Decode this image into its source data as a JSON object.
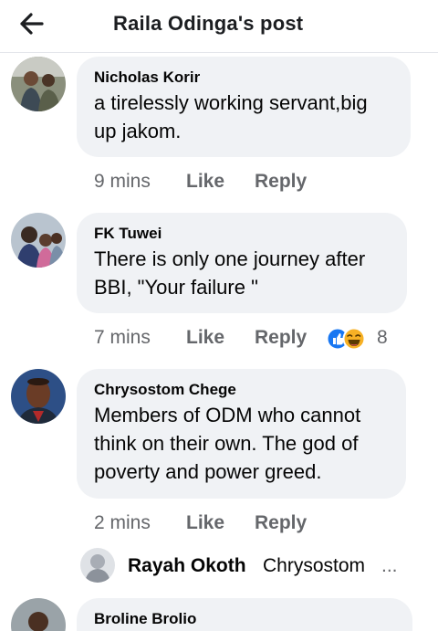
{
  "header": {
    "title": "Raila Odinga's post",
    "back_icon": "back-arrow-icon"
  },
  "comments": [
    {
      "author": "Nicholas Korir",
      "lines": [
        "a tirelessly working servant,big",
        "up jakom."
      ],
      "time": "9 mins",
      "like": "Like",
      "reply": "Reply"
    },
    {
      "author": "FK Tuwei",
      "lines": [
        "There is only one journey after",
        "BBI, \"Your failure \""
      ],
      "time": "7 mins",
      "like": "Like",
      "reply": "Reply",
      "reaction_count": "8",
      "reactions": [
        "like",
        "haha"
      ]
    },
    {
      "author": "Chrysostom Chege",
      "lines": [
        "Members of ODM who cannot",
        "think on their own. The god of",
        "poverty and power greed."
      ],
      "time": "2 mins",
      "like": "Like",
      "reply": "Reply"
    },
    {
      "author": "Broline Brolio"
    }
  ],
  "reply_preview": {
    "name": "Rayah Okoth",
    "text": "Chrysostom",
    "ellipsis": "..."
  },
  "colors": {
    "bubble": "#f0f2f5",
    "meta": "#65676b",
    "like_blue": "#1877f2",
    "haha_yellow": "#f7b125"
  }
}
